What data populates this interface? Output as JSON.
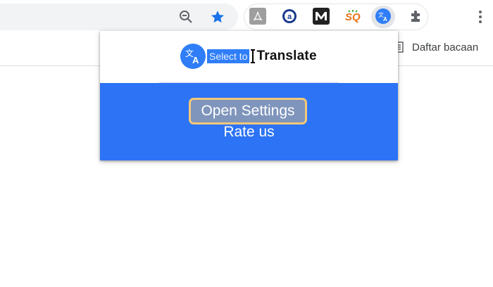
{
  "toolbar": {
    "extensions": [
      "pdf-extension",
      "a-extension",
      "m-extension",
      "sq-extension",
      "select-to-translate-extension",
      "extensions-puzzle"
    ]
  },
  "bookmarks_bar": {
    "reading_list_label": "Daftar bacaan"
  },
  "popup": {
    "brand_select_text": "Select to",
    "brand_translate_text": "Translate",
    "open_settings_label": "Open Settings",
    "rate_us_label": "Rate us"
  },
  "colors": {
    "popup_blue": "#2c73f5",
    "highlight_border": "#f2c979",
    "button_bg": "#7f95bc",
    "chrome_accent": "#1a73e8"
  }
}
